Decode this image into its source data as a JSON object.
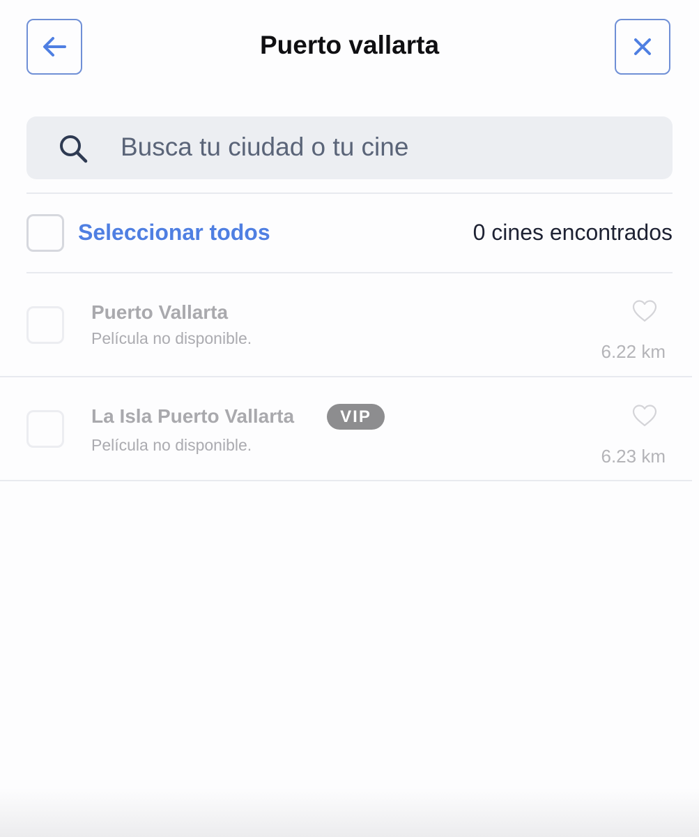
{
  "header": {
    "title": "Puerto vallarta",
    "back_icon": "arrow-left-icon",
    "close_icon": "close-icon",
    "accent_color": "#4f7fe2"
  },
  "search": {
    "placeholder": "Busca tu ciudad o tu cine",
    "value": "",
    "icon": "search-icon"
  },
  "selection": {
    "select_all_label": "Seleccionar todos",
    "select_all_checked": false,
    "count_text": "0 cines encontrados"
  },
  "cinemas": [
    {
      "name": "Puerto Vallarta",
      "status": "Película no disponible.",
      "distance": "6.22 km",
      "badge": "",
      "checked": false,
      "favorite": false
    },
    {
      "name": "La Isla Puerto Vallarta",
      "status": "Película no disponible.",
      "distance": "6.23 km",
      "badge": "VIP",
      "checked": false,
      "favorite": false
    }
  ]
}
